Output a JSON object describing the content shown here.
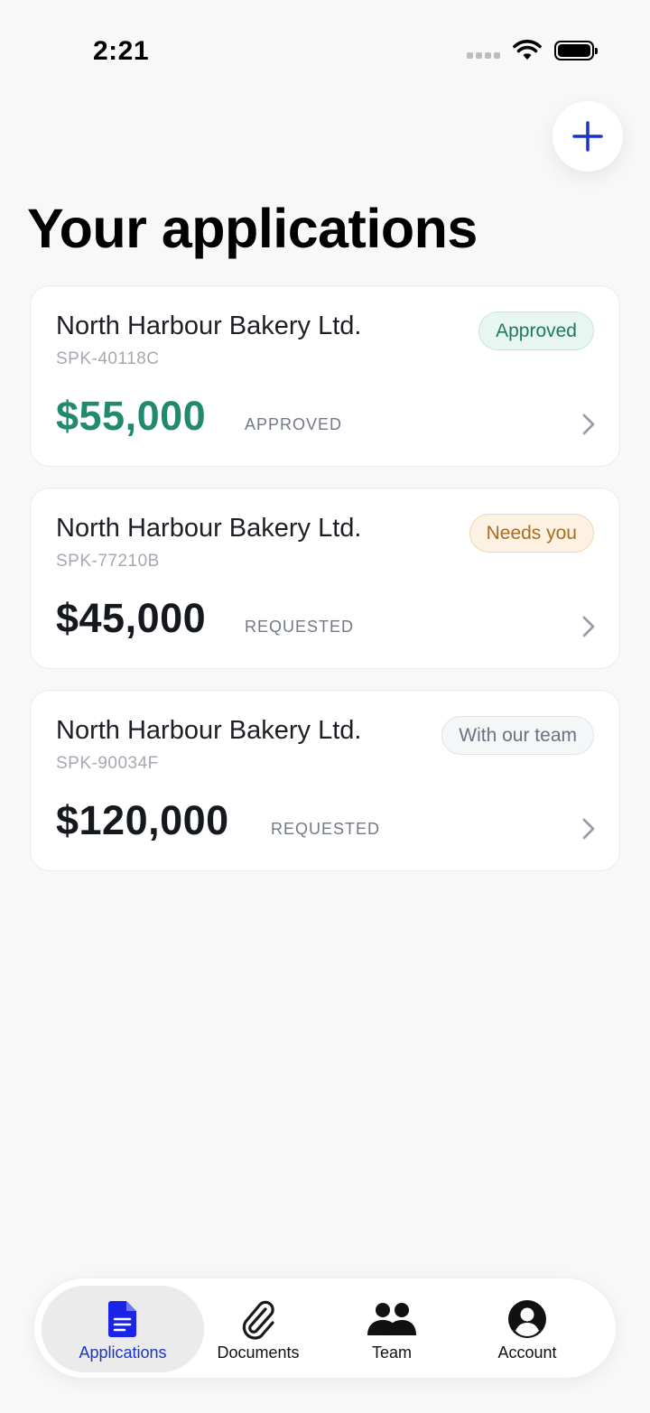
{
  "status_bar": {
    "time": "2:21"
  },
  "header": {
    "title": "Your applications"
  },
  "applications": [
    {
      "name": "North Harbour Bakery Ltd.",
      "reference": "SPK-40118C",
      "badge": "Approved",
      "amount": "$55,000",
      "amount_label": "APPROVED"
    },
    {
      "name": "North Harbour Bakery Ltd.",
      "reference": "SPK-77210B",
      "badge": "Needs you",
      "amount": "$45,000",
      "amount_label": "REQUESTED"
    },
    {
      "name": "North Harbour Bakery Ltd.",
      "reference": "SPK-90034F",
      "badge": "With our team",
      "amount": "$120,000",
      "amount_label": "REQUESTED"
    }
  ],
  "tabs": [
    {
      "label": "Applications",
      "icon": "document-icon",
      "active": true
    },
    {
      "label": "Documents",
      "icon": "paperclip-icon",
      "active": false
    },
    {
      "label": "Team",
      "icon": "people-icon",
      "active": false
    },
    {
      "label": "Account",
      "icon": "account-icon",
      "active": false
    }
  ],
  "colors": {
    "accent": "#1a33c8",
    "approved": "#228a6c",
    "needs_you": "#a86d22",
    "with_team": "#6b7280",
    "background": "#f8f8f9"
  }
}
